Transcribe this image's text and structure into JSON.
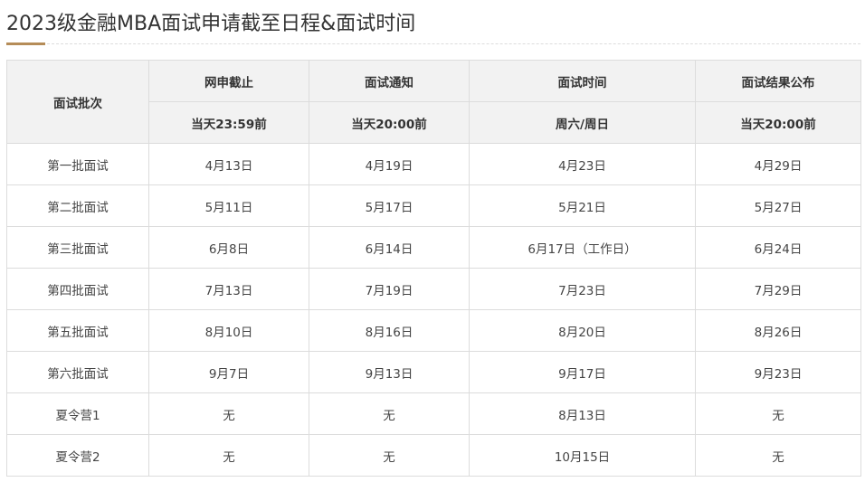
{
  "title": "2023级金融MBA面试申请截至日程&面试时间",
  "colors": {
    "accent": "#b58c58",
    "header_bg": "#f2f2f2",
    "border": "#dcdcdc"
  },
  "table": {
    "batch_header": "面试批次",
    "headers": [
      "网申截止",
      "面试通知",
      "面试时间",
      "面试结果公布"
    ],
    "subheaders": [
      "当天23:59前",
      "当天20:00前",
      "周六/周日",
      "当天20:00前"
    ],
    "rows": [
      [
        "第一批面试",
        "4月13日",
        "4月19日",
        "4月23日",
        "4月29日"
      ],
      [
        "第二批面试",
        "5月11日",
        "5月17日",
        "5月21日",
        "5月27日"
      ],
      [
        "第三批面试",
        "6月8日",
        "6月14日",
        "6月17日（工作日）",
        "6月24日"
      ],
      [
        "第四批面试",
        "7月13日",
        "7月19日",
        "7月23日",
        "7月29日"
      ],
      [
        "第五批面试",
        "8月10日",
        "8月16日",
        "8月20日",
        "8月26日"
      ],
      [
        "第六批面试",
        "9月7日",
        "9月13日",
        "9月17日",
        "9月23日"
      ],
      [
        "夏令营1",
        "无",
        "无",
        "8月13日",
        "无"
      ],
      [
        "夏令营2",
        "无",
        "无",
        "10月15日",
        "无"
      ]
    ]
  }
}
